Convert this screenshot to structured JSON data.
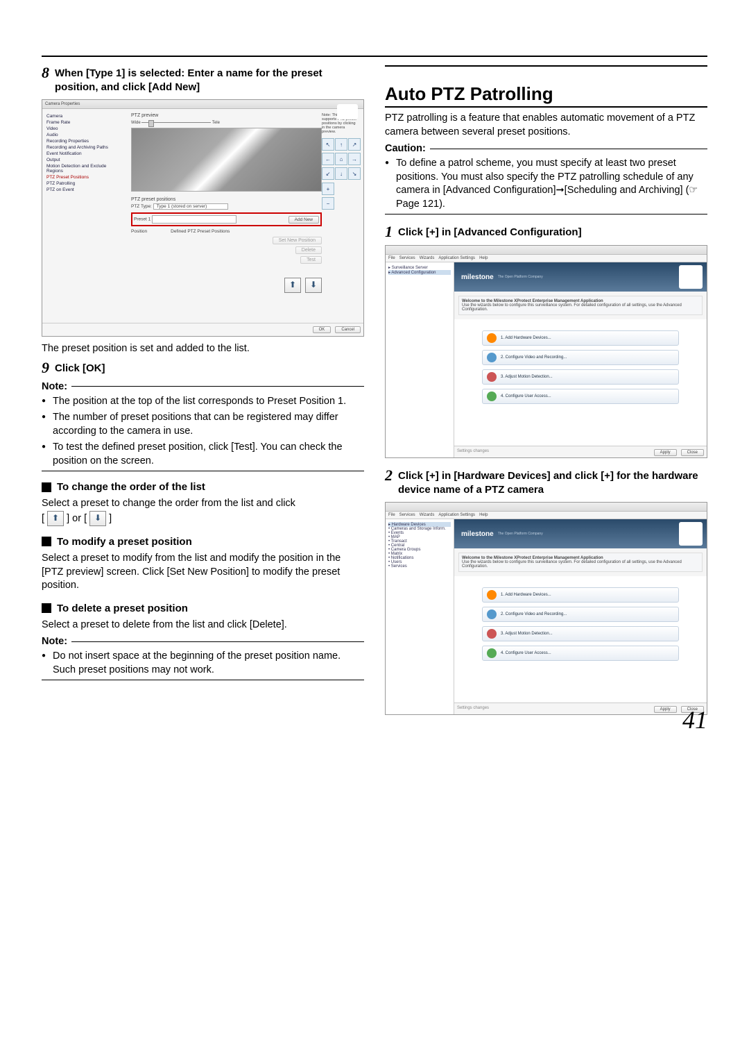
{
  "page_number": "41",
  "left": {
    "step8": {
      "num": "8",
      "text": "When [Type 1] is selected: Enter a name for the preset position, and click [Add New]"
    },
    "cam_props": {
      "title": "Camera Properties",
      "side_items": [
        "Camera",
        "Frame Rate",
        "Video",
        "Audio",
        "Recording Properties",
        "Recording and Archiving Paths",
        "Event Notification",
        "Output",
        "Motion Detection and Exclude Regions",
        "PTZ Preset Positions",
        "PTZ Patrolling",
        "PTZ on Event"
      ],
      "side_selected": "PTZ Preset Positions",
      "preview_label": "PTZ preview",
      "wide": "Wide",
      "tele": "Tele",
      "note_right": "Note: This camera supports PTZ preset positions by clicking in the camera preview.",
      "ptz_positions_label": "PTZ preset positions",
      "ptz_type": "PTZ Type:",
      "type_value": "Type 1 (stored on server)",
      "preset_label": "Preset 1",
      "position_label": "Position",
      "defined_label": "Defined PTZ Preset Positions",
      "add_new": "Add New",
      "set_new": "Set New Position",
      "delete": "Delete",
      "test": "Test",
      "ok": "OK",
      "cancel": "Cancel"
    },
    "after8": "The preset position is set and added to the list.",
    "step9": {
      "num": "9",
      "text": "Click [OK]"
    },
    "note_label": "Note:",
    "notes9": [
      "The position at the top of the list corresponds to Preset Position 1.",
      "The number of preset positions that can be registered may differ according to the camera in use.",
      "To test the defined preset position, click [Test]. You can check the position on the screen."
    ],
    "sub_change": "To change the order of the list",
    "change_text_a": "Select a preset to change the order from the list and click",
    "change_text_b": "[",
    "change_text_c": "] or [",
    "change_text_d": "]",
    "sub_modify": "To modify a preset position",
    "modify_text": "Select a preset to modify from the list and modify the position in the [PTZ preview] screen. Click [Set New Position] to modify the preset position.",
    "sub_delete": "To delete a preset position",
    "delete_text": "Select a preset to delete from the list and click [Delete].",
    "note2_label": "Note:",
    "notes_del": [
      "Do not insert space at the beginning of the preset position name. Such preset positions may not work."
    ]
  },
  "right": {
    "heading": "Auto PTZ Patrolling",
    "intro": "PTZ patrolling is a feature that enables automatic movement of a PTZ camera between several preset positions.",
    "caution_label": "Caution:",
    "caution_items": [
      "To define a patrol scheme, you must specify at least two preset positions. You must also specify the PTZ patrolling schedule of any camera in [Advanced Configuration]➞[Scheduling and Archiving] (☞ Page 121)."
    ],
    "step1": {
      "num": "1",
      "text": "Click [+] in [Advanced Configuration]"
    },
    "mgmt": {
      "menubar": [
        "File",
        "Services",
        "Wizards",
        "Application Settings",
        "Help"
      ],
      "brand": "milestone",
      "tagline": "The Open Platform Company",
      "welcome_title": "Welcome to the Milestone XProtect Enterprise Management Application",
      "welcome_sub": "Use the wizards below to configure this surveillance system. For detailed configuration of all settings, use the Advanced Configuration.",
      "wizard": [
        "1. Add Hardware Devices...",
        "2. Configure Video and Recording...",
        "3. Adjust Motion Detection...",
        "4. Configure User Access..."
      ],
      "footer_left": "Settings changes",
      "apply": "Apply",
      "close": "Close",
      "tree1": [
        "Surveillance Server",
        "Advanced Configuration"
      ],
      "tree2": [
        "Hardware Devices",
        "Cameras and Storage Inform.",
        "Events",
        "MAP",
        "Transact",
        "Central",
        "Camera Groups",
        "Matrix",
        "Notifications",
        "Users",
        "Services"
      ]
    },
    "step2": {
      "num": "2",
      "text": "Click [+] in [Hardware Devices] and click [+] for the hardware device name of a PTZ camera"
    }
  }
}
